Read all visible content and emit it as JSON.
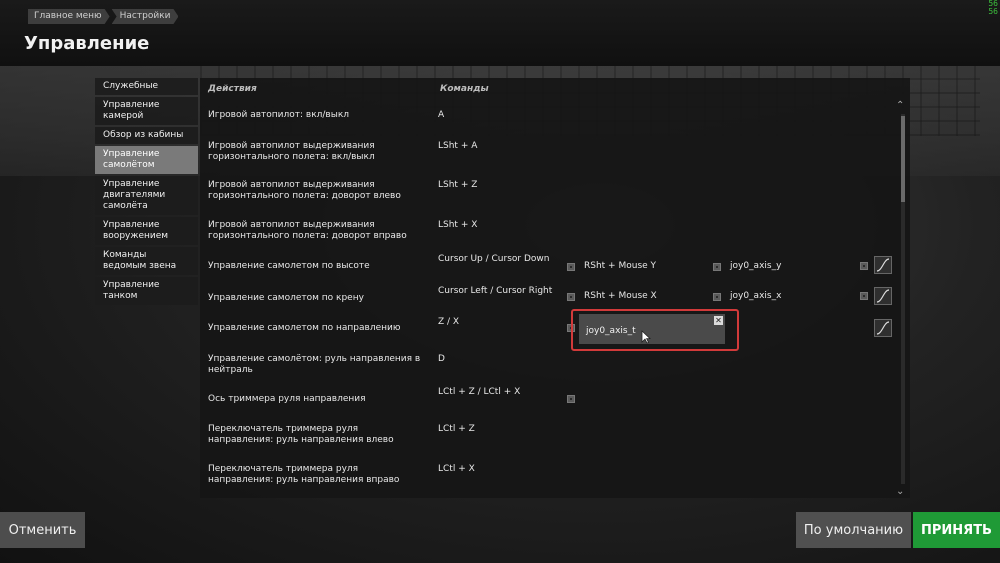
{
  "fps": [
    "56",
    "56"
  ],
  "breadcrumb": [
    "Главное меню",
    "Настройки"
  ],
  "title": "Управление",
  "sidebar": {
    "items": [
      {
        "label": "Служебные",
        "active": false
      },
      {
        "label": "Управление камерой",
        "active": false
      },
      {
        "label": "Обзор из кабины",
        "active": false
      },
      {
        "label": "Управление самолётом",
        "active": true
      },
      {
        "label": "Управление двигателями самолёта",
        "active": false
      },
      {
        "label": "Управление вооружением",
        "active": false
      },
      {
        "label": "Команды ведомым звена",
        "active": false
      },
      {
        "label": "Управление танком",
        "active": false
      }
    ]
  },
  "table": {
    "col_actions": "Действия",
    "col_commands": "Команды",
    "rows": [
      {
        "action": "Игровой автопилот: вкл/выкл",
        "command": "A"
      },
      {
        "action": "Игровой автопилот выдерживания горизонтального полета: вкл/выкл",
        "command": "LSht + A"
      },
      {
        "action": "Игровой автопилот выдерживания горизонтального полета: доворот влево",
        "command": "LSht + Z"
      },
      {
        "action": "Игровой автопилот выдерживания горизонтального полета: доворот вправо",
        "command": "LSht + X"
      },
      {
        "action": "Управление самолетом по высоте",
        "command": "Cursor Up / Cursor Down",
        "bind2": "RSht + Mouse Y",
        "bind3": "joy0_axis_y"
      },
      {
        "action": "Управление самолетом по крену",
        "command": "Cursor Left / Cursor Right",
        "bind2": "RSht + Mouse X",
        "bind3": "joy0_axis_x"
      },
      {
        "action": "Управление самолетом по направлению",
        "command": "Z / X"
      },
      {
        "action": "Управление самолётом: руль направления в нейтраль",
        "command": "D"
      },
      {
        "action": "Ось триммера руля направления",
        "command": "LCtl + Z / LCtl + X"
      },
      {
        "action": "Переключатель триммера руля направления: руль направления влево",
        "command": "LCtl + Z"
      },
      {
        "action": "Переключатель триммера руля направления: руль направления вправо",
        "command": "LCtl + X"
      }
    ]
  },
  "popup": {
    "text": "joy0_axis_t",
    "close": "✕"
  },
  "buttons": {
    "cancel": "Отменить",
    "default": "По умолчанию",
    "accept": "ПРИНЯТЬ"
  },
  "colors": {
    "accept": "#1f9a36",
    "popup_border": "#d23a3a",
    "active_side": "#7a7a7a"
  }
}
